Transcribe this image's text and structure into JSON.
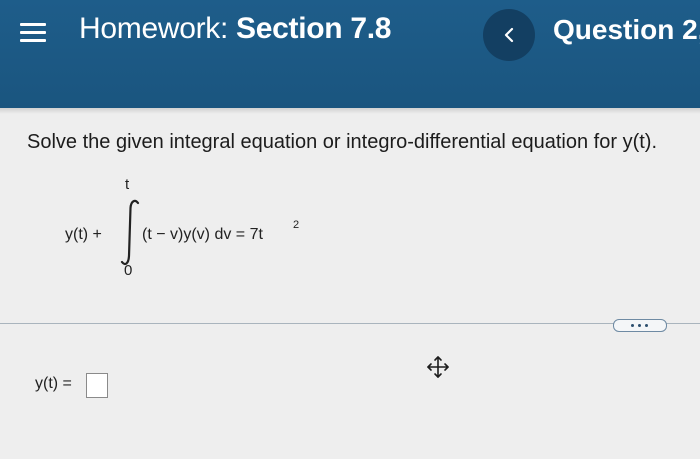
{
  "header": {
    "menu_icon": "hamburger-menu-icon",
    "title_prefix": "Homework:",
    "title_section": "Section 7.8",
    "prev_icon": "chevron-left-icon",
    "question_label": "Question 2,",
    "colors": {
      "header_bg": "#1e5d8a",
      "prev_button_bg": "#133f62"
    }
  },
  "question": {
    "prompt": "Solve the given integral equation or integro-differential equation for y(t).",
    "equation": {
      "lhs": "y(t) +",
      "upper_limit": "t",
      "lower_limit": "0",
      "integrand": "(t − v)y(v) dv = 7t",
      "exponent": "2"
    }
  },
  "toolbar": {
    "more_icon": "more-options-icon",
    "move_icon": "move-cursor-icon"
  },
  "answer": {
    "label": "y(t) =",
    "value": ""
  }
}
